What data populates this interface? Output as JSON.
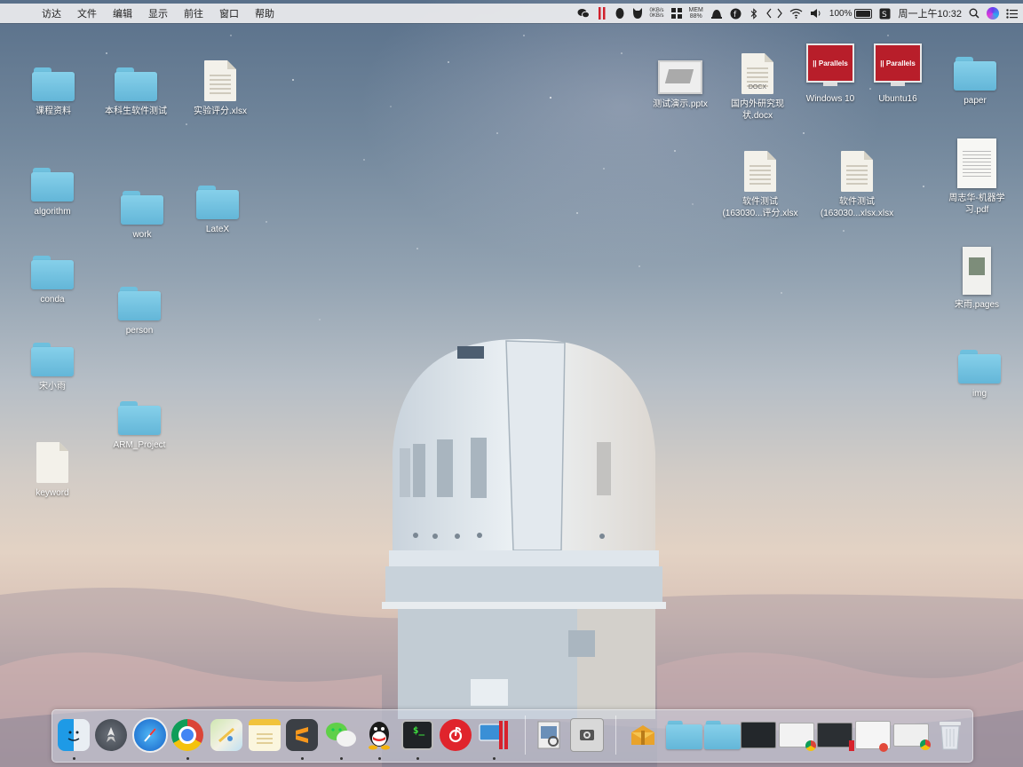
{
  "menubar": {
    "apple_glyph": "",
    "menus": [
      "访达",
      "文件",
      "编辑",
      "显示",
      "前往",
      "窗口",
      "帮助"
    ],
    "netspeed_up": "0KB/s",
    "netspeed_down": "0KB/s",
    "mem_label": "MEM",
    "mem_value": "88%",
    "battery_percent": "100%",
    "clock": "周一上午10:32"
  },
  "desktop_left": [
    {
      "label": "课程资料",
      "kind": "folder"
    },
    {
      "label": "本科生软件测试",
      "kind": "folder"
    },
    {
      "label": "实验评分.xlsx",
      "kind": "document"
    },
    {
      "label": "algorithm",
      "kind": "folder"
    },
    {
      "label": "work",
      "kind": "folder"
    },
    {
      "label": "LateX",
      "kind": "folder"
    },
    {
      "label": "conda",
      "kind": "folder"
    },
    {
      "label": "person",
      "kind": "folder"
    },
    {
      "label": "宋小雨",
      "kind": "folder"
    },
    {
      "label": "ARM_Project",
      "kind": "folder"
    },
    {
      "label": "keyword",
      "kind": "document"
    }
  ],
  "desktop_right": [
    {
      "label": "测试演示.pptx",
      "kind": "pptx"
    },
    {
      "label": "国内外研究现\n状.docx",
      "kind": "docx",
      "tag": "DOCX"
    },
    {
      "label": "Windows 10",
      "kind": "vm",
      "brand": "|| Parallels"
    },
    {
      "label": "Ubuntu16",
      "kind": "vm",
      "brand": "|| Parallels"
    },
    {
      "label": "paper",
      "kind": "folder"
    },
    {
      "label": "软件测试\n(163030...评分.xlsx",
      "kind": "document"
    },
    {
      "label": "软件测试\n(163030...xlsx.xlsx",
      "kind": "document"
    },
    {
      "label": "周志华-机器学\n习.pdf",
      "kind": "pdf"
    },
    {
      "label": "宋雨.pages",
      "kind": "pages"
    },
    {
      "label": "img",
      "kind": "folder"
    }
  ],
  "dock": {
    "apps": [
      {
        "name": "Finder",
        "icon": "finder-icon",
        "running": true
      },
      {
        "name": "Launchpad",
        "icon": "launchpad-icon",
        "running": false
      },
      {
        "name": "Safari",
        "icon": "safari-icon",
        "running": false
      },
      {
        "name": "Google Chrome",
        "icon": "chrome-icon",
        "running": true
      },
      {
        "name": "Maps",
        "icon": "maps-icon",
        "running": false
      },
      {
        "name": "Notes",
        "icon": "notes-icon",
        "running": false
      },
      {
        "name": "Sublime Text",
        "icon": "sublime-icon",
        "running": true
      },
      {
        "name": "WeChat",
        "icon": "wechat-icon",
        "running": true
      },
      {
        "name": "QQ",
        "icon": "qq-icon",
        "running": true
      },
      {
        "name": "Terminal",
        "icon": "terminal-icon",
        "running": true
      },
      {
        "name": "NetEase Music",
        "icon": "netease-music-icon",
        "running": false
      },
      {
        "name": "Parallels Desktop",
        "icon": "parallels-icon",
        "running": true
      },
      {
        "name": "Preview",
        "icon": "preview-icon",
        "running": false
      },
      {
        "name": "Screenshot",
        "icon": "screenshot-icon",
        "running": false
      }
    ],
    "stacks": [
      {
        "name": "Archive Utility",
        "icon": "archive-icon"
      },
      {
        "name": "Applications",
        "icon": "folder-icon"
      },
      {
        "name": "Documents",
        "icon": "folder-icon"
      },
      {
        "name": "Terminal window",
        "icon": "terminal-window-icon"
      },
      {
        "name": "Chrome window",
        "icon": "chrome-window-icon"
      },
      {
        "name": "Parallels window",
        "icon": "parallels-window-icon"
      },
      {
        "name": "Document window",
        "icon": "document-window-icon"
      },
      {
        "name": "Chrome window 2",
        "icon": "chrome-window-icon"
      },
      {
        "name": "Trash",
        "icon": "trash-icon"
      }
    ]
  }
}
